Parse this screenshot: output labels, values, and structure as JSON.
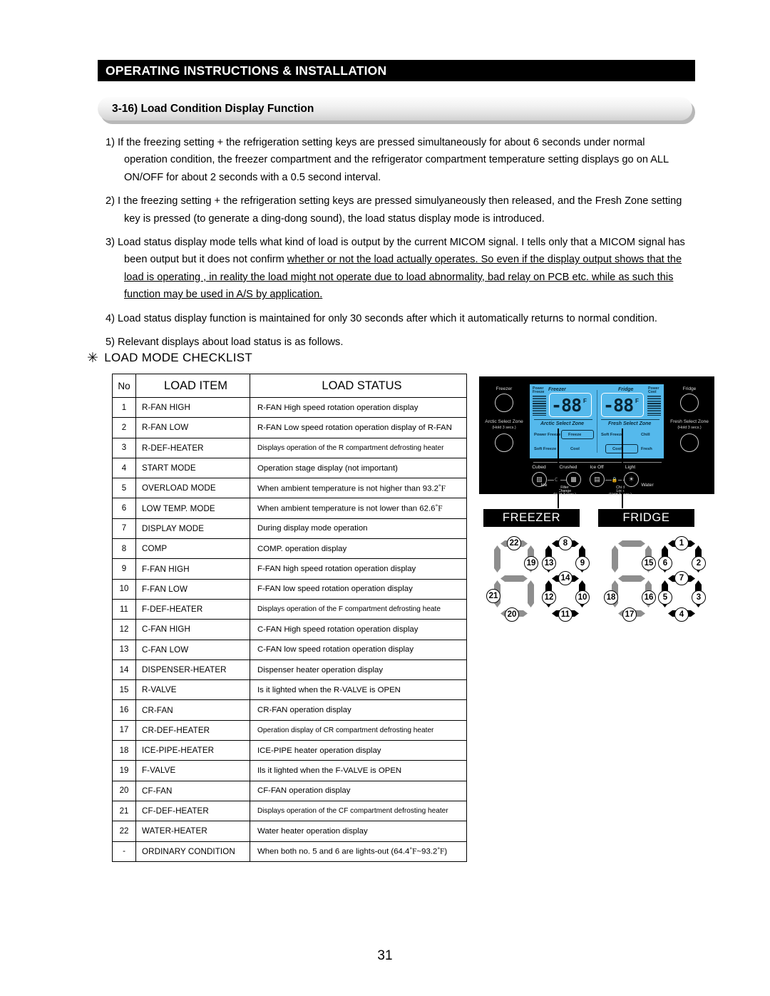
{
  "header": {
    "title": "OPERATING INSTRUCTIONS & INSTALLATION"
  },
  "section": {
    "title": "3-16) Load Condition Display Function"
  },
  "paragraphs": [
    {
      "num": "1)",
      "pre": "If the freezing setting + the refrigeration setting keys are pressed simultaneously for about 6 seconds under normal operation condition, the freezer compartment and the refrigerator compartment temperature setting displays go on ALL ON/OFF for about 2 seconds with a 0.5 second interval.",
      "underlined": ""
    },
    {
      "num": "2)",
      "pre": "I the freezing setting + the refrigeration setting keys are pressed simulyaneously then released, and the Fresh Zone setting key is pressed (to generate a ding-dong sound), the load status display mode is introduced.",
      "underlined": ""
    },
    {
      "num": "3)",
      "pre": "Load status display mode tells what kind of load is output by the current MICOM signal. I tells only that a MICOM signal has been output but it does not confirm ",
      "underlined": "whether or not the load actually operates. So even if the display output shows that the load is operating , in reality the load might not operate due to load abnormality, bad relay on PCB etc. while as such this function may be used in A/S by application."
    },
    {
      "num": "4)",
      "pre": "Load status display function is maintained for only 30 seconds after which it automatically returns to normal condition.",
      "underlined": ""
    },
    {
      "num": "5)",
      "pre": "Relevant displays about load status is as follows.",
      "underlined": ""
    }
  ],
  "checklist": {
    "star": "✳",
    "heading": "LOAD MODE CHECKLIST",
    "columns": {
      "no": "No",
      "item": "LOAD ITEM",
      "status": "LOAD STATUS"
    },
    "rows": [
      {
        "no": "1",
        "item": "R-FAN HIGH",
        "status": "R-FAN High speed rotation operation display",
        "small": false
      },
      {
        "no": "2",
        "item": "R-FAN LOW",
        "status": "R-FAN Low speed rotation operation display of R-FAN",
        "small": false
      },
      {
        "no": "3",
        "item": "R-DEF-HEATER",
        "status": "Displays operation of the R compartment defrosting heater",
        "small": true
      },
      {
        "no": "4",
        "item": "START MODE",
        "status": "Operation stage display (not important)",
        "small": false
      },
      {
        "no": "5",
        "item": "OVERLOAD MODE",
        "status": "When ambient temperature is not higher than 93.2°F",
        "small": false
      },
      {
        "no": "6",
        "item": "LOW TEMP. MODE",
        "status": "When ambient temperature is not lower than 62.6°F",
        "small": false
      },
      {
        "no": "7",
        "item": "DISPLAY MODE",
        "status": "During display mode operation",
        "small": false
      },
      {
        "no": "8",
        "item": "COMP",
        "status": "COMP. operation display",
        "small": false
      },
      {
        "no": "9",
        "item": "F-FAN HIGH",
        "status": "F-FAN high speed rotation operation display",
        "small": false
      },
      {
        "no": "10",
        "item": "F-FAN LOW",
        "status": "F-FAN low speed rotation operation display",
        "small": false
      },
      {
        "no": "11",
        "item": "F-DEF-HEATER",
        "status": "Displays operation of the F compartment defrosting heate",
        "small": true
      },
      {
        "no": "12",
        "item": "C-FAN HIGH",
        "status": "C-FAN High speed rotation operation display",
        "small": false
      },
      {
        "no": "13",
        "item": "C-FAN LOW",
        "status": "C-FAN low speed rotation operation display",
        "small": false
      },
      {
        "no": "14",
        "item": "DISPENSER-HEATER",
        "status": "Dispenser heater operation display",
        "small": false
      },
      {
        "no": "15",
        "item": "R-VALVE",
        "status": "Is it lighted when the R-VALVE is OPEN",
        "small": false
      },
      {
        "no": "16",
        "item": "CR-FAN",
        "status": "CR-FAN operation display",
        "small": false
      },
      {
        "no": "17",
        "item": "CR-DEF-HEATER",
        "status": "Operation display of CR compartment defrosting heater",
        "small": true
      },
      {
        "no": "18",
        "item": "ICE-PIPE-HEATER",
        "status": "ICE-PIPE heater operation display",
        "small": false
      },
      {
        "no": "19",
        "item": "F-VALVE",
        "status": "Ils it lighted when the F-VALVE is OPEN",
        "small": false
      },
      {
        "no": "20",
        "item": "CF-FAN",
        "status": "CF-FAN operation display",
        "small": false
      },
      {
        "no": "21",
        "item": "CF-DEF-HEATER",
        "status": "Displays operation of the CF compartment defrosting heater",
        "small": true
      },
      {
        "no": "22",
        "item": "WATER-HEATER",
        "status": "Water heater operation display",
        "small": false
      },
      {
        "no": "-",
        "item": "ORDINARY CONDITION",
        "status": "When both no. 5 and 6 are lights-out (64.4°F~93.2°F)",
        "small": false
      }
    ]
  },
  "control_panel": {
    "left_buttons": [
      {
        "label": "Freezer",
        "sub": ""
      },
      {
        "label": "Arctic Select Zone",
        "sub": "(Hold 3 secs.)"
      }
    ],
    "right_buttons": [
      {
        "label": "Fridge",
        "sub": ""
      },
      {
        "label": "Fresh Select Zone",
        "sub": "(Hold 3 secs.)"
      }
    ],
    "lcd": {
      "left": {
        "power_label_line1": "Power",
        "power_label_line2": "Freeze",
        "title": "Freezer",
        "value": "-88",
        "unit": "F",
        "zone_title": "Arctic Select Zone",
        "options": [
          "Power Freeze",
          "Freeze",
          "Soft Freeze",
          "Cool"
        ],
        "selected": "Freeze"
      },
      "right": {
        "power_label_line1": "Power",
        "power_label_line2": "Cool",
        "title": "Fridge",
        "value": "-88",
        "unit": "F",
        "zone_title": "Fresh Select Zone",
        "options": [
          "Soft Freeze",
          "Chill",
          "Cool",
          "Fresh"
        ],
        "selected": "Cool"
      }
    },
    "dispenser": {
      "ice_group_label": "Ice",
      "water_group_label": "Water",
      "buttons": [
        "Cubed",
        "Crushed",
        "Ice Off",
        "Light"
      ],
      "filter_change": "Filter\nChange\n(Hold 3 secs.)",
      "filter_change_l1": "Filter",
      "filter_change_l2": "Change",
      "filter_change_l3": "(Hold 3 secs.)",
      "child_lock_l1": "Child",
      "child_lock_l2": "Lock",
      "child_lock_l3": "(Hold 3 secs.)"
    }
  },
  "segment_map": {
    "banners": {
      "freezer": "FREEZER",
      "fridge": "FRIDGE"
    },
    "freezer_digit1": {
      "top": "22",
      "top_right": "19",
      "bottom_left": "21",
      "bottom": "20",
      "on": []
    },
    "freezer_digit2": {
      "top": "8",
      "top_left": "13",
      "top_right": "9",
      "middle": "14",
      "bottom_left": "12",
      "bottom_right": "10",
      "bottom": "11",
      "on": [
        "top",
        "top_left",
        "top_right",
        "middle",
        "bottom_left",
        "bottom_right",
        "bottom"
      ]
    },
    "fridge_digit1": {
      "top_right": "15",
      "bottom_left": "18",
      "bottom_right": "16",
      "bottom": "17",
      "on": []
    },
    "fridge_digit2": {
      "top": "1",
      "top_left": "6",
      "top_right": "2",
      "middle": "7",
      "bottom_left": "5",
      "bottom_right": "3",
      "bottom": "4",
      "on": [
        "top",
        "top_left",
        "top_right",
        "middle",
        "bottom_left",
        "bottom_right",
        "bottom"
      ]
    }
  },
  "footer": {
    "page_number": "31"
  },
  "colors": {
    "ink": "#000000",
    "lcd_blue": "#55b9ec",
    "segment_on": "#000000",
    "segment_off": "#8e8e8e"
  }
}
